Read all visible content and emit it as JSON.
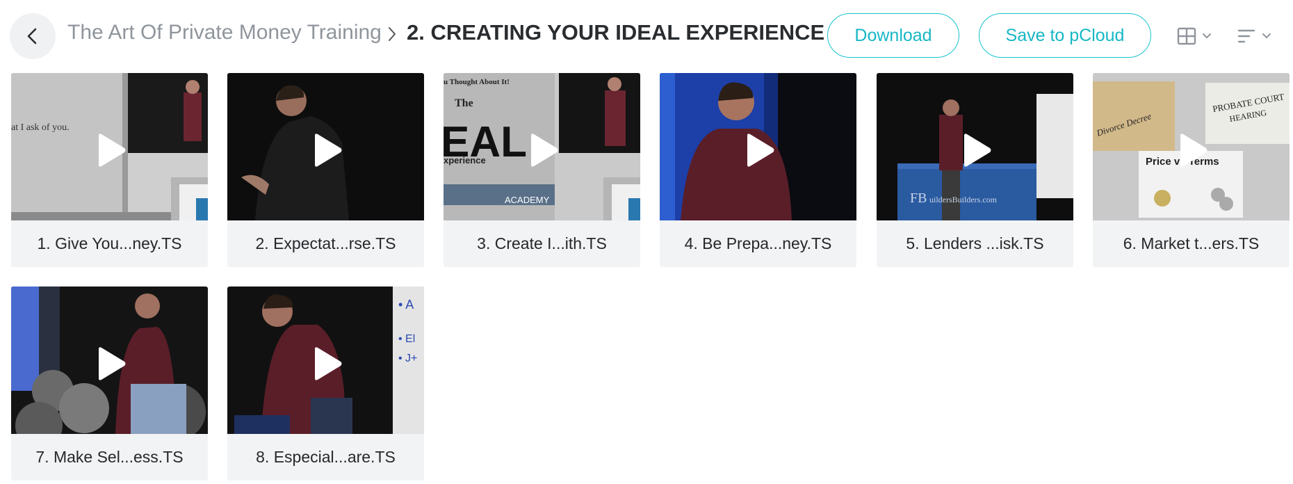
{
  "header": {
    "back_icon": "chevron-left-icon",
    "breadcrumb_parent": "The Art Of Private Money Training",
    "breadcrumb_separator_icon": "chevron-right-icon",
    "breadcrumb_current": "2. CREATING YOUR IDEAL EXPERIENCE",
    "download_label": "Download",
    "save_label": "Save to pCloud",
    "view_icon": "grid-view-icon",
    "sort_icon": "sort-lines-icon",
    "dropdown_icon": "chevron-down-icon"
  },
  "colors": {
    "accent": "#17c2cf",
    "card_bg": "#f2f3f5",
    "muted_text": "#8f959c"
  },
  "files": [
    {
      "label": "1. Give You...ney.TS",
      "thumb_text": "at I ask of you."
    },
    {
      "label": "2. Expectat...rse.TS",
      "thumb_text": ""
    },
    {
      "label": "3. Create I...ith.TS",
      "thumb_text": "u Thought About It!",
      "thumb_text_2": "The",
      "thumb_text_3": "EAL",
      "thumb_text_4": "xperience",
      "thumb_text_5": "ACADEMY"
    },
    {
      "label": "4. Be Prepa...ney.TS",
      "thumb_text": ""
    },
    {
      "label": "5. Lenders ...isk.TS",
      "thumb_text": "FB",
      "thumb_text_2": "uildersBuilders.com"
    },
    {
      "label": "6. Market t...ers.TS",
      "thumb_text": "Divorce Decree",
      "thumb_text_2": "PROBATE COURT",
      "thumb_text_3": "HEARING",
      "thumb_text_4": "Price vs Terms"
    },
    {
      "label": "7. Make Sel...ess.TS",
      "thumb_text": ""
    },
    {
      "label": "8. Especial...are.TS",
      "thumb_text": "• A",
      "thumb_text_2": "• El",
      "thumb_text_3": "• J+"
    }
  ]
}
